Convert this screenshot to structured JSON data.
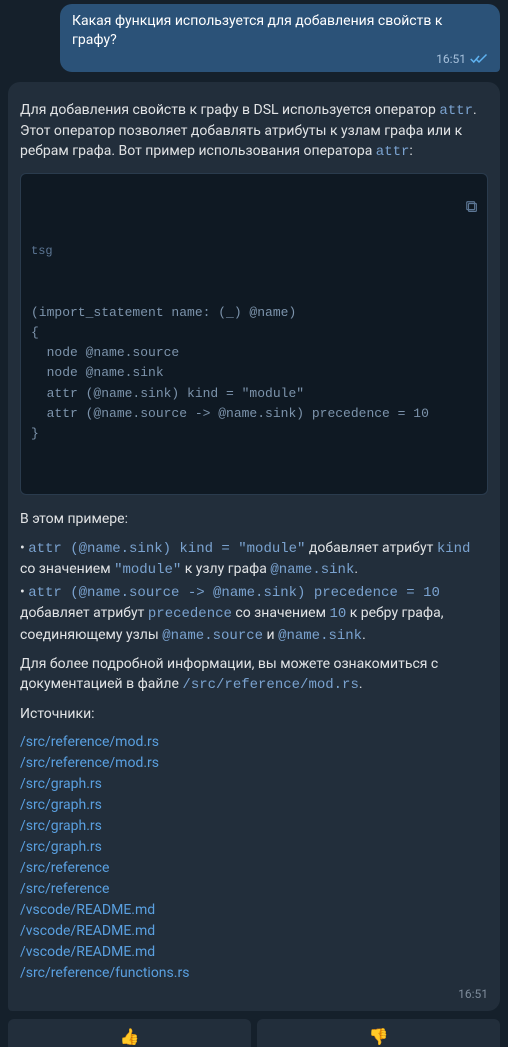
{
  "outgoing": {
    "text": "Какая функция используется для добавления свойств к графу?",
    "time": "16:51"
  },
  "incoming": {
    "intro_pre": "Для добавления свойств к графу в DSL используется оператор ",
    "intro_op": "attr",
    "intro_post": ". Этот оператор позволяет добавлять атрибуты к узлам графа или к ребрам графа. Вот пример использования оператора ",
    "intro_op2": "attr",
    "intro_end": ":",
    "code_lang": "tsg",
    "code_body": "(import_statement name: (_) @name)\n{\n  node @name.source\n  node @name.sink\n  attr (@name.sink) kind = \"module\"\n  attr (@name.source -> @name.sink) precedence = 10\n}",
    "example_header": "В этом примере:",
    "b1_code": "attr (@name.sink) kind = \"module\"",
    "b1_mid1": " добавляет атрибут ",
    "b1_kind": "kind",
    "b1_mid2": " со значением ",
    "b1_val": "\"module\"",
    "b1_mid3": " к узлу графа ",
    "b1_node": "@name.sink",
    "b1_end": ".",
    "b2_code": "attr (@name.source -> @name.sink) precedence = 10",
    "b2_mid1": " добавляет атрибут ",
    "b2_prec": "precedence",
    "b2_mid2": " со значением ",
    "b2_val": "10",
    "b2_mid3": " к ребру графа, соединяющему узлы ",
    "b2_src": "@name.source",
    "b2_and": " и ",
    "b2_sink": "@name.sink",
    "b2_end": ".",
    "more_pre": "Для более подробной информации, вы можете ознакомиться с документацией в файле ",
    "more_path": "/src/reference/mod.rs",
    "more_end": ".",
    "sources_label": "Источники:",
    "sources": [
      "/src/reference/mod.rs",
      "/src/reference/mod.rs",
      "/src/graph.rs",
      "/src/graph.rs",
      "/src/graph.rs",
      "/src/graph.rs",
      "/src/reference",
      "/src/reference",
      "/vscode/README.md",
      "/vscode/README.md",
      "/vscode/README.md",
      "/src/reference/functions.rs"
    ],
    "time": "16:51"
  },
  "reactions": {
    "up": "👍",
    "down": "👎"
  }
}
